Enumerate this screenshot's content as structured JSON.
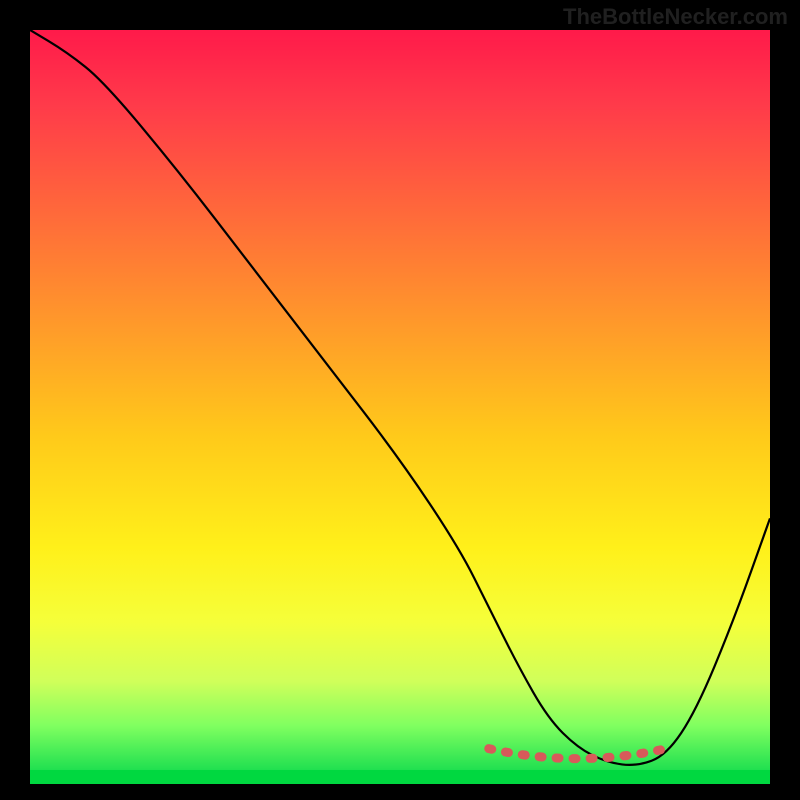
{
  "watermark": "TheBottleNecker.com",
  "chart_data": {
    "type": "line",
    "title": "",
    "xlabel": "",
    "ylabel": "",
    "xlim": [
      0,
      100
    ],
    "ylim": [
      0,
      100
    ],
    "series": [
      {
        "name": "curve",
        "x": [
          0,
          5,
          10,
          20,
          30,
          40,
          50,
          58,
          62,
          66,
          70,
          74,
          78,
          82,
          86,
          90,
          95,
          100
        ],
        "y": [
          100,
          97,
          93,
          81,
          68,
          55,
          42,
          30,
          22,
          14,
          7,
          3,
          1,
          0.5,
          2,
          8,
          20,
          34
        ]
      }
    ],
    "highlight": {
      "name": "marker-strip",
      "x_start": 62,
      "x_end": 86,
      "y": 1,
      "color": "#d85a5a"
    },
    "background_gradient": {
      "top": "#ff1a4a",
      "bottom": "#20e050"
    }
  }
}
